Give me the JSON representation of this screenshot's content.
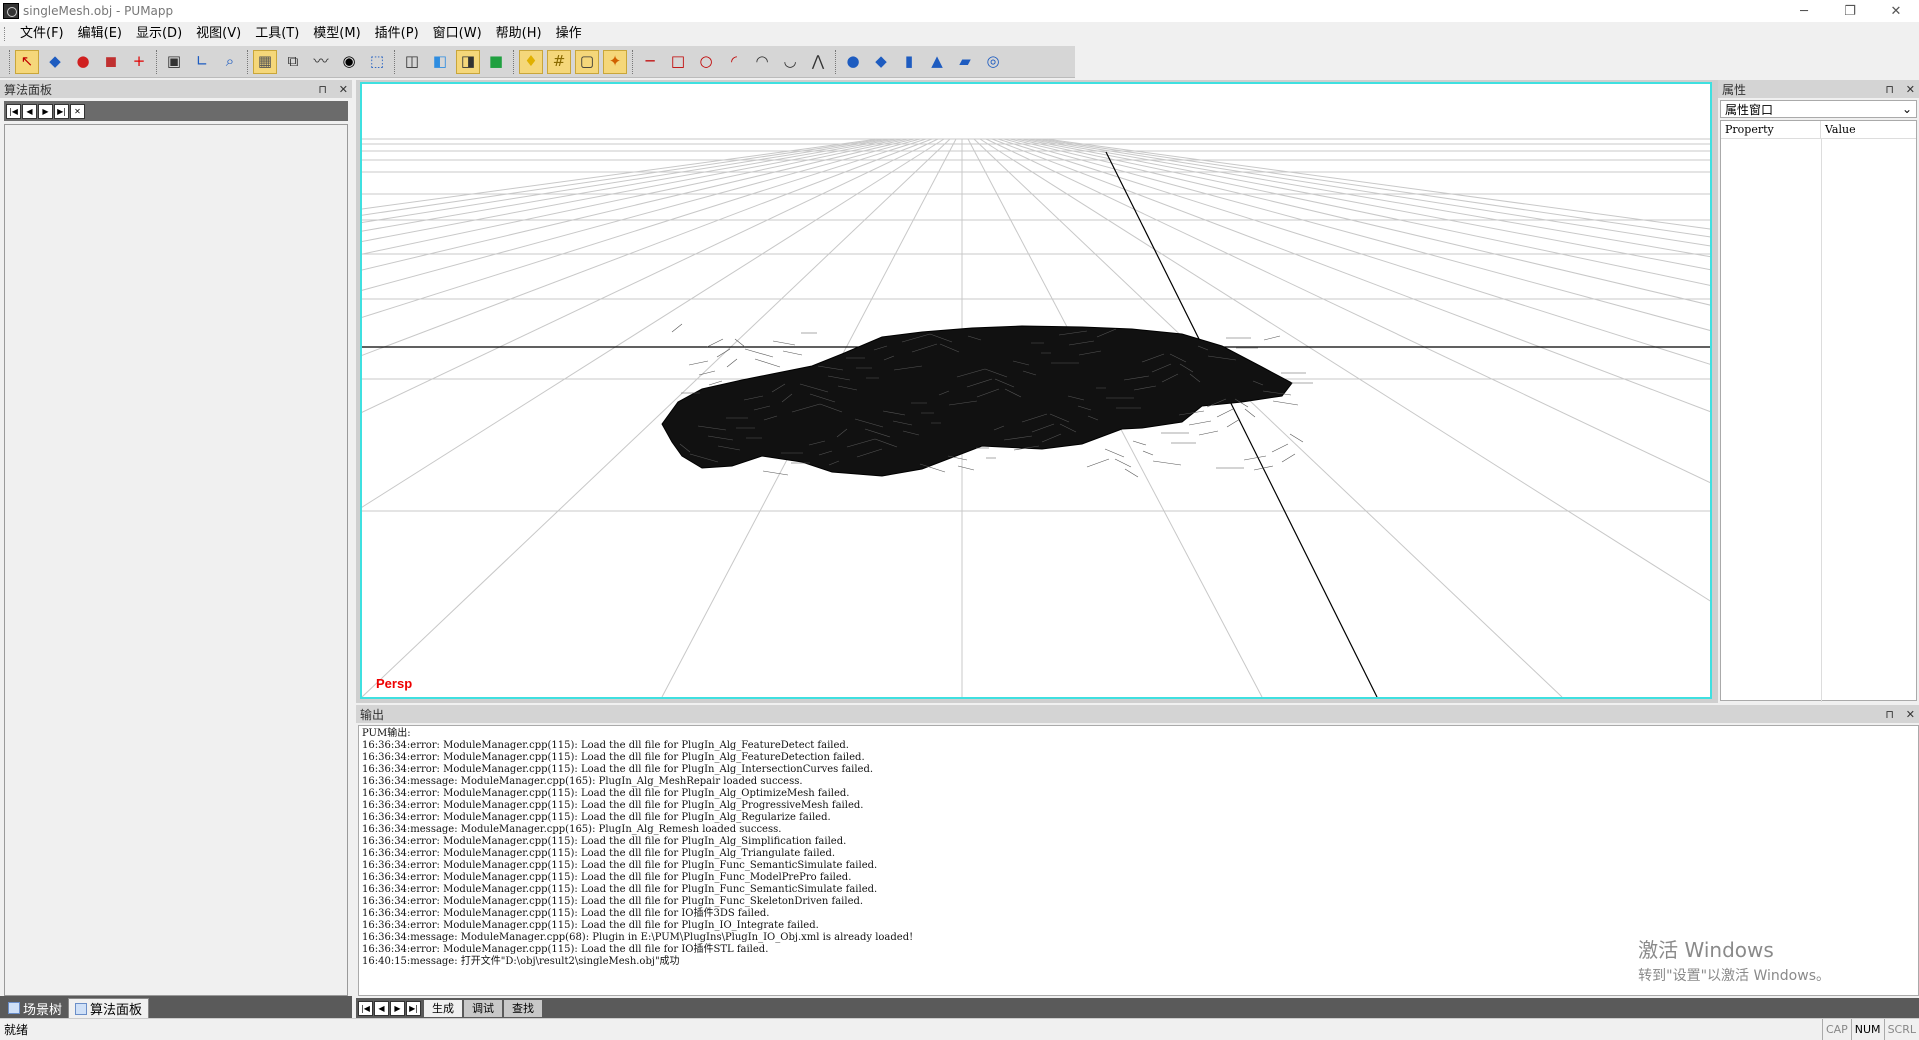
{
  "window": {
    "title": "singleMesh.obj - PUMapp",
    "minimize": "─",
    "restore": "❐",
    "close": "✕"
  },
  "menu": [
    "文件(F)",
    "编辑(E)",
    "显示(D)",
    "视图(V)",
    "工具(T)",
    "模型(M)",
    "插件(P)",
    "窗口(W)",
    "帮助(H)",
    "操作"
  ],
  "toolbar": {
    "buttons": [
      {
        "name": "select-arrow-icon",
        "glyph": "↖",
        "color": "#c00000",
        "active": true
      },
      {
        "name": "mesh-shape-icon",
        "glyph": "◆",
        "color": "#1e5cc0"
      },
      {
        "name": "mesh-red-icon",
        "glyph": "●",
        "color": "#d02020"
      },
      {
        "name": "mesh-cube-icon",
        "glyph": "◼",
        "color": "#c03030"
      },
      {
        "name": "crosshair-icon",
        "glyph": "+",
        "color": "#e00000"
      },
      {
        "sep": true
      },
      {
        "name": "pick-point-icon",
        "glyph": "▣",
        "color": "#333333"
      },
      {
        "name": "axis-icon",
        "glyph": "∟",
        "color": "#1e5cc0"
      },
      {
        "name": "zoom-icon",
        "glyph": "⌕",
        "color": "#1e5cc0"
      },
      {
        "sep": true
      },
      {
        "name": "grid-select-icon",
        "glyph": "▦",
        "color": "#555555",
        "active": true
      },
      {
        "name": "box-select-icon",
        "glyph": "⧉",
        "color": "#333333"
      },
      {
        "name": "curve-icon",
        "glyph": "〰",
        "color": "#333333"
      },
      {
        "name": "eye-icon",
        "glyph": "◉",
        "color": "#000000"
      },
      {
        "name": "transform-icon",
        "glyph": "⬚",
        "color": "#1e5cc0"
      },
      {
        "sep": true
      },
      {
        "name": "wireframe-box-icon",
        "glyph": "◫",
        "color": "#333333"
      },
      {
        "name": "solid-box-icon",
        "glyph": "◧",
        "color": "#2f8de0"
      },
      {
        "name": "shaded-box-icon",
        "glyph": "◨",
        "color": "#333333",
        "active": true
      },
      {
        "name": "color-box-icon",
        "glyph": "■",
        "color": "#20a040"
      },
      {
        "sep": true
      },
      {
        "name": "light-bulb-icon",
        "glyph": "♦",
        "color": "#e0b000",
        "active": true
      },
      {
        "name": "grid-toggle-icon",
        "glyph": "#",
        "color": "#8a6a00",
        "active": true
      },
      {
        "name": "bbox-toggle-icon",
        "glyph": "▢",
        "color": "#333333",
        "active": true
      },
      {
        "name": "axes-toggle-icon",
        "glyph": "✦",
        "color": "#d06000",
        "active": true
      },
      {
        "sep": true
      },
      {
        "name": "line-tool-icon",
        "glyph": "─",
        "color": "#c00000"
      },
      {
        "name": "rect-tool-icon",
        "glyph": "□",
        "color": "#c00000"
      },
      {
        "name": "circle-tool-icon",
        "glyph": "○",
        "color": "#c00000"
      },
      {
        "name": "arc-tool-icon",
        "glyph": "◜",
        "color": "#c00000"
      },
      {
        "name": "arc2-tool-icon",
        "glyph": "◠",
        "color": "#333333"
      },
      {
        "name": "bezier-tool-icon",
        "glyph": "◡",
        "color": "#333333"
      },
      {
        "name": "polyline-tool-icon",
        "glyph": "⋀",
        "color": "#333333"
      },
      {
        "sep": true
      },
      {
        "name": "sphere-icon",
        "glyph": "●",
        "color": "#1e5cc0"
      },
      {
        "name": "cube-icon",
        "glyph": "◆",
        "color": "#1e5cc0"
      },
      {
        "name": "cylinder-icon",
        "glyph": "▮",
        "color": "#1e5cc0"
      },
      {
        "name": "cone-icon",
        "glyph": "▲",
        "color": "#1e5cc0"
      },
      {
        "name": "plane-icon",
        "glyph": "▰",
        "color": "#1e5cc0"
      },
      {
        "name": "torus-icon",
        "glyph": "◎",
        "color": "#1e5cc0"
      }
    ]
  },
  "left_panel": {
    "title": "算法面板",
    "pin": "⊓",
    "close": "✕",
    "nav": [
      "|◀",
      "◀",
      "▶",
      "▶|",
      "✕"
    ]
  },
  "left_tabs": [
    "场景树",
    "算法面板"
  ],
  "viewport": {
    "label": "Persp"
  },
  "properties": {
    "title": "属性",
    "selector": "属性窗口",
    "col_property": "Property",
    "col_value": "Value",
    "pin": "⊓",
    "close": "✕"
  },
  "output": {
    "title": "输出",
    "pin": "⊓",
    "close": "✕",
    "lines": [
      "PUM输出:",
      "16:36:34:error: ModuleManager.cpp(115): Load the dll file for PlugIn_Alg_FeatureDetect failed.",
      "16:36:34:error: ModuleManager.cpp(115): Load the dll file for PlugIn_Alg_FeatureDetection failed.",
      "16:36:34:error: ModuleManager.cpp(115): Load the dll file for PlugIn_Alg_IntersectionCurves failed.",
      "16:36:34:message: ModuleManager.cpp(165): PlugIn_Alg_MeshRepair loaded success.",
      "16:36:34:error: ModuleManager.cpp(115): Load the dll file for PlugIn_Alg_OptimizeMesh failed.",
      "16:36:34:error: ModuleManager.cpp(115): Load the dll file for PlugIn_Alg_ProgressiveMesh failed.",
      "16:36:34:error: ModuleManager.cpp(115): Load the dll file for PlugIn_Alg_Regularize failed.",
      "16:36:34:message: ModuleManager.cpp(165): PlugIn_Alg_Remesh loaded success.",
      "16:36:34:error: ModuleManager.cpp(115): Load the dll file for PlugIn_Alg_Simplification failed.",
      "16:36:34:error: ModuleManager.cpp(115): Load the dll file for PlugIn_Alg_Triangulate failed.",
      "16:36:34:error: ModuleManager.cpp(115): Load the dll file for PlugIn_Func_SemanticSimulate failed.",
      "16:36:34:error: ModuleManager.cpp(115): Load the dll file for PlugIn_Func_ModelPrePro failed.",
      "16:36:34:error: ModuleManager.cpp(115): Load the dll file for PlugIn_Func_SemanticSimulate failed.",
      "16:36:34:error: ModuleManager.cpp(115): Load the dll file for PlugIn_Func_SkeletonDriven failed.",
      "16:36:34:error: ModuleManager.cpp(115): Load the dll file for IO插件3DS failed.",
      "16:36:34:error: ModuleManager.cpp(115): Load the dll file for PlugIn_IO_Integrate failed.",
      "16:36:34:message: ModuleManager.cpp(68): Plugin in E:\\PUM\\PlugIns\\PlugIn_IO_Obj.xml is already loaded!",
      "16:36:34:error: ModuleManager.cpp(115): Load the dll file for IO插件STL failed.",
      "16:40:15:message: 打开文件\"D:\\obj\\result2\\singleMesh.obj\"成功"
    ],
    "tabs": [
      "生成",
      "调试",
      "查找"
    ],
    "nav": [
      "|◀",
      "◀",
      "▶",
      "▶|"
    ]
  },
  "watermark": {
    "line1": "激活 Windows",
    "line2": "转到\"设置\"以激活 Windows。"
  },
  "status": {
    "text": "就绪",
    "indicators": [
      "CAP",
      "NUM",
      "SCRL"
    ],
    "active": "NUM"
  }
}
